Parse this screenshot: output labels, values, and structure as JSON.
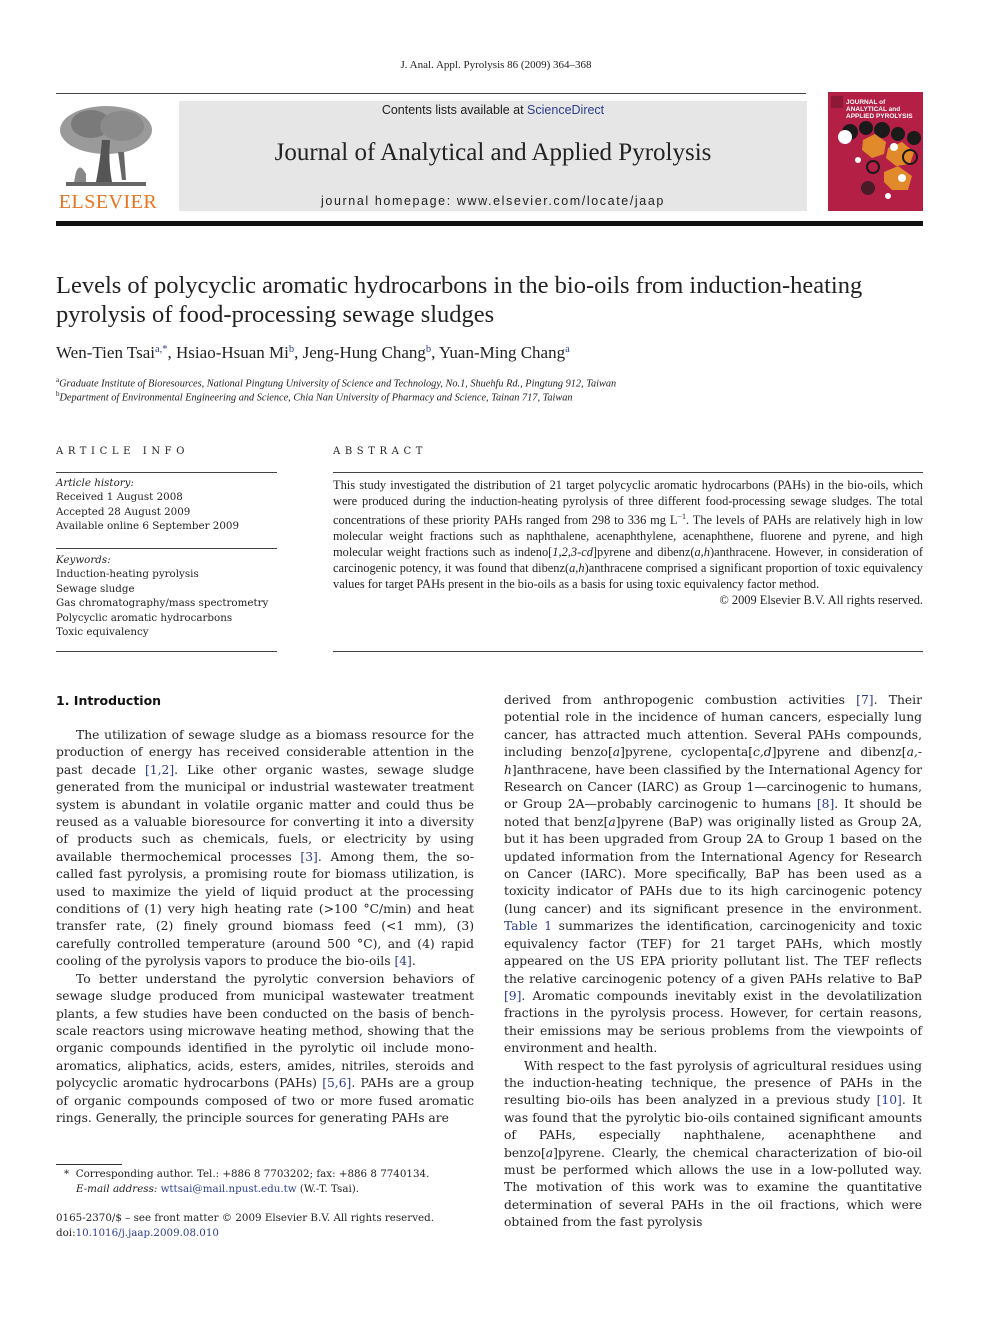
{
  "citation": "J. Anal. Appl.  Pyrolysis  86 (2009) 364–368",
  "publisher": {
    "logo_text": "ELSEVIER",
    "logo_color": "#e8731f"
  },
  "banner": {
    "contents_prefix": "Contents lists available at ",
    "contents_link": "ScienceDirect",
    "journal_title": "Journal of Analytical and Applied Pyrolysis",
    "homepage": "journal homepage: www.elsevier.com/locate/jaap"
  },
  "cover": {
    "title_lines": [
      "JOURNAL of",
      "ANALYTICAL and",
      "APPLIED PYROLYSIS"
    ],
    "color": "#b41f45"
  },
  "article": {
    "title_line1": "Levels of polycyclic aromatic hydrocarbons in the bio-oils from induction-heating",
    "title_line2": "pyrolysis of food-processing sewage sludges",
    "authors": [
      {
        "name": "Wen-Tien Tsai",
        "sup": "a,*",
        "sep": ", "
      },
      {
        "name": "Hsiao-Hsuan Mi",
        "sup": "b",
        "sep": ", "
      },
      {
        "name": "Jeng-Hung Chang",
        "sup": "b",
        "sep": ", "
      },
      {
        "name": "Yuan-Ming Chang",
        "sup": "a",
        "sep": ""
      }
    ],
    "affiliations": [
      {
        "key": "a",
        "text": "Graduate Institute of Bioresources, National Pingtung University of Science and Technology, No.1, Shuehfu Rd., Pingtung 912, Taiwan"
      },
      {
        "key": "b",
        "text": "Department of Environmental Engineering and Science, Chia Nan University of Pharmacy and Science, Tainan 717, Taiwan"
      }
    ]
  },
  "article_info": {
    "heading": "ARTICLE INFO",
    "history_label": "Article history:",
    "history": [
      "Received 1 August 2008",
      "Accepted 28 August 2009",
      "Available online 6 September 2009"
    ],
    "keywords_label": "Keywords:",
    "keywords": [
      "Induction-heating pyrolysis",
      "Sewage sludge",
      "Gas chromatography/mass spectrometry",
      "Polycyclic aromatic hydrocarbons",
      "Toxic equivalency"
    ]
  },
  "abstract": {
    "heading": "ABSTRACT",
    "text_part1": "This study investigated the distribution of 21 target polycyclic aromatic hydrocarbons (PAHs) in the bio-oils, which were produced during the induction-heating pyrolysis of three different food-processing sewage sludges. The total concentrations of these priority PAHs ranged from 298 to 336 mg L",
    "text_sup": "−1",
    "text_part2": ". The levels of PAHs are relatively high in low molecular weight fractions such as naphthalene, acenaphthylene, acenaphthene, fluorene and pyrene, and high molecular weight fractions such as indeno[",
    "italic1": "1,2,3-cd",
    "text_part3": "]pyrene and dibenz(",
    "italic2": "a,h",
    "text_part4": ")anthracene. However, in consideration of carcinogenic potency, it was found that dibenz(",
    "italic3": "a,h",
    "text_part5": ")anthracene comprised a significant proportion of toxic equivalency values for target PAHs present in the bio-oils as a basis for using toxic equivalency factor method.",
    "copyright": "© 2009 Elsevier B.V. All rights reserved."
  },
  "intro": {
    "heading": "1.  Introduction",
    "p1": [
      {
        "t": "The utilization of sewage sludge as a biomass resource for the production of energy has received considerable attention in the past decade "
      },
      {
        "ref": "[1,2]"
      },
      {
        "t": ". Like other organic wastes, sewage sludge generated from the municipal or industrial wastewater treatment system is abundant in volatile organic matter and could thus be reused as a valuable bioresource for converting it into a diversity of products such as chemicals, fuels, or electricity by using available thermochemical processes "
      },
      {
        "ref": "[3]"
      },
      {
        "t": ". Among them, the so-called fast pyrolysis, a promising route for biomass utilization, is used to maximize the yield of liquid product at the processing conditions of (1) very high heating rate (>100 °C/min) and heat transfer rate, (2) finely ground biomass feed (<1 mm), (3) carefully controlled temperature (around 500 °C), and (4) rapid cooling of the pyrolysis vapors to produce the bio-oils "
      },
      {
        "ref": "[4]"
      },
      {
        "t": "."
      }
    ],
    "p2": [
      {
        "t": "To better understand the pyrolytic conversion behaviors of sewage sludge produced from municipal wastewater treatment plants, a few studies have been conducted on the basis of bench-scale reactors using microwave heating method, showing that the organic compounds identified in the pyrolytic oil include mono-aromatics, aliphatics, acids, esters, amides, nitriles, steroids and polycyclic aromatic hydrocarbons (PAHs) "
      },
      {
        "ref": "[5,6]"
      },
      {
        "t": ". PAHs are a group of organic compounds composed of two or more fused aromatic rings. Generally, the principle sources for generating PAHs are"
      }
    ],
    "p3": [
      {
        "t": "derived from anthropogenic combustion activities "
      },
      {
        "ref": "[7]"
      },
      {
        "t": ". Their potential role in the incidence of human cancers, especially lung cancer, has attracted much attention. Several PAHs compounds, including benzo["
      },
      {
        "i": "a"
      },
      {
        "t": "]pyrene, cyclopenta["
      },
      {
        "i": "c,d"
      },
      {
        "t": "]pyrene and dibenz["
      },
      {
        "i": "a,-h"
      },
      {
        "t": "]anthracene, have been classified by the International Agency for Research on Cancer (IARC) as Group 1—carcinogenic to humans, or Group 2A—probably carcinogenic to humans "
      },
      {
        "ref": "[8]"
      },
      {
        "t": ". It should be noted that benz["
      },
      {
        "i": "a"
      },
      {
        "t": "]pyrene (BaP) was originally listed as Group 2A, but it has been upgraded from Group 2A to Group 1 based on the updated information from the International Agency for Research on Cancer (IARC). More specifically, BaP has been used as a toxicity indicator of PAHs due to its high carcinogenic potency (lung cancer) and its significant presence in the environment. "
      },
      {
        "ref": "Table 1"
      },
      {
        "t": " summarizes the identification, carcinogenicity and toxic equivalency factor (TEF) for 21 target PAHs, which mostly appeared on the US EPA priority pollutant list. The TEF reflects the relative carcinogenic potency of a given PAHs relative to BaP "
      },
      {
        "ref": "[9]"
      },
      {
        "t": ". Aromatic compounds inevitably exist in the devolatilization fractions in the pyrolysis process. However, for certain reasons, their emissions may be serious problems from the viewpoints of environment and health."
      }
    ],
    "p4": [
      {
        "t": "With respect to the fast pyrolysis of agricultural residues using the induction-heating technique, the presence of PAHs in the resulting bio-oils has been analyzed in a previous study "
      },
      {
        "ref": "[10]"
      },
      {
        "t": ". It was found that the pyrolytic bio-oils contained significant amounts of PAHs, especially naphthalene, acenaphthene and benzo["
      },
      {
        "i": "a"
      },
      {
        "t": "]pyrene. Clearly, the chemical characterization of bio-oil must be performed which allows the use in a low-polluted way. The motivation of this work was to examine the quantitative determination of several PAHs in the oil fractions, which were obtained from the fast pyrolysis"
      }
    ]
  },
  "footnote": {
    "star": "*",
    "corresponding": "Corresponding author. Tel.: +886 8 7703202; fax: +886 8 7740134.",
    "email_label": "E-mail address:",
    "email": "wttsai@mail.npust.edu.tw",
    "email_suffix": " (W.-T. Tsai).",
    "front_matter": "0165-2370/$ – see front matter © 2009 Elsevier B.V. All rights reserved.",
    "doi_prefix": "doi:",
    "doi": "10.1016/j.jaap.2009.08.010"
  }
}
